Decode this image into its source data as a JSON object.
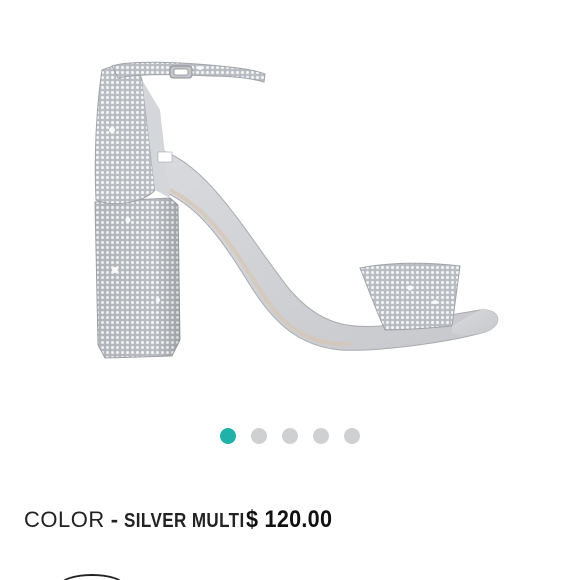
{
  "product": {
    "image_alt": "Silver rhinestone block heel ankle-strap sandal",
    "color_label": "COLOR",
    "color_separator": "-",
    "color_value": "SILVER MULTI",
    "price": "$ 120.00"
  },
  "carousel": {
    "total": 5,
    "active_index": 0,
    "active_color": "#20b2a8",
    "inactive_color": "#cfd0d2"
  }
}
